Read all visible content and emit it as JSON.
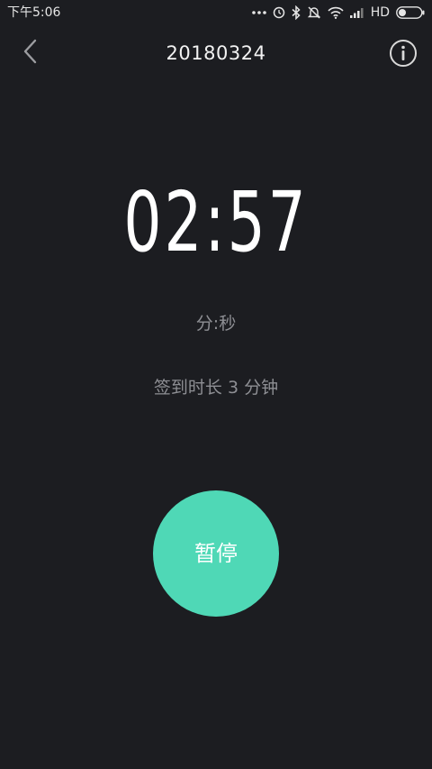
{
  "status_bar": {
    "time": "下午5:06",
    "network_label": "HD",
    "icons": [
      "more-dots-icon",
      "alarm-icon",
      "bluetooth-icon",
      "mute-icon",
      "wifi-icon",
      "signal-icon",
      "battery-icon"
    ]
  },
  "header": {
    "title": "20180324",
    "back_icon": "chevron-left-icon",
    "info_icon": "info-icon"
  },
  "timer": {
    "value": "02:57",
    "unit_label": "分:秒",
    "checkin_duration": "签到时长 3 分钟"
  },
  "pause_button": {
    "label": "暂停",
    "color": "#4fd8b6"
  },
  "colors": {
    "background": "#1c1d21",
    "accent": "#4fd8b6",
    "secondary_text": "#8e8f94"
  }
}
